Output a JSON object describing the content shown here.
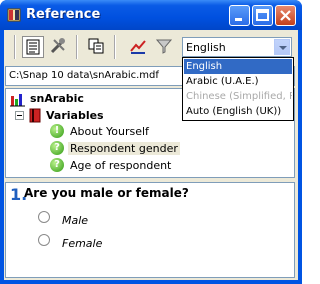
{
  "window": {
    "title": "Reference"
  },
  "toolbar": {
    "buttons": [
      {
        "icon": "document-properties-icon",
        "pressed": true
      },
      {
        "icon": "tools-icon",
        "pressed": false
      },
      {
        "icon": "copy-icon",
        "pressed": false
      },
      {
        "icon": "chart-icon",
        "pressed": false
      },
      {
        "icon": "filter-icon",
        "pressed": false
      }
    ],
    "language": {
      "selected": "English",
      "options": [
        {
          "label": "English",
          "state": "selected"
        },
        {
          "label": "Arabic (U.A.E.)",
          "state": "normal"
        },
        {
          "label": "Chinese (Simplified, PR",
          "state": "disabled"
        },
        {
          "label": "Auto (English (UK))",
          "state": "normal"
        }
      ]
    }
  },
  "path": {
    "value": "C:\\Snap 10 data\\snArabic.mdf"
  },
  "tree": {
    "root": "snArabic",
    "group": "Variables",
    "items": [
      "About Yourself",
      "Respondent gender",
      "Age of respondent"
    ],
    "selected_index": 1
  },
  "preview": {
    "question_number": "1.",
    "question_text": "Are you male or female?",
    "options": [
      "Male",
      "Female"
    ]
  },
  "colors": {
    "titlebar": "#0054e3",
    "selection": "#316ac5",
    "question_number": "#1f5fbf"
  }
}
